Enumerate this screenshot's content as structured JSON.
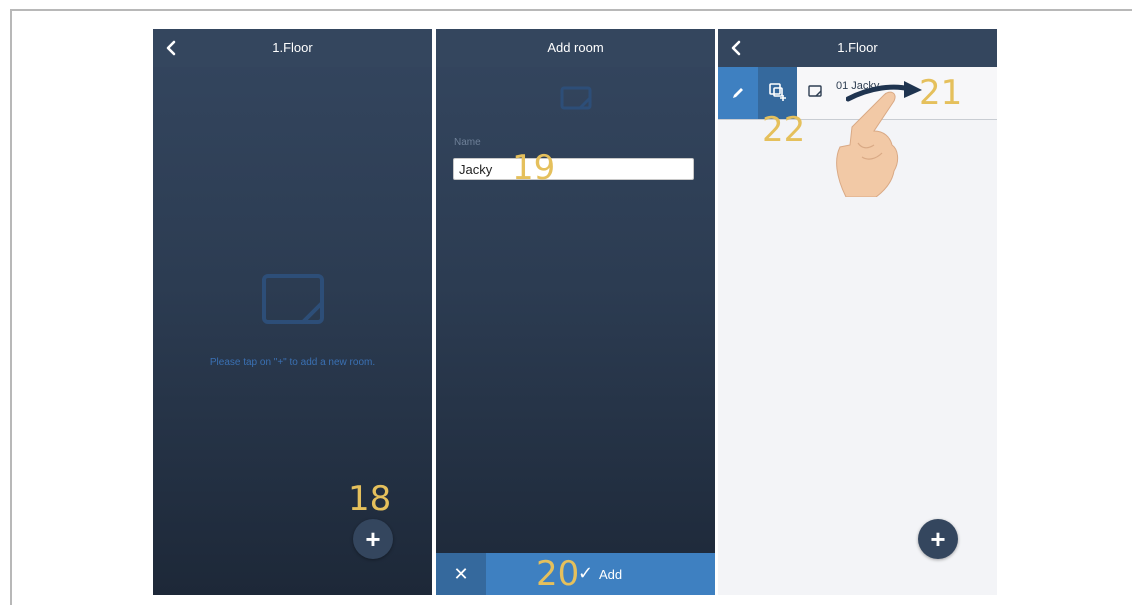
{
  "panels": [
    {
      "nav_title": "1.Floor",
      "empty_hint": "Please tap on \"+\" to add a new room.",
      "fab_label": "+",
      "annotation": "18"
    },
    {
      "nav_title": "Add room",
      "name_label": "Name",
      "name_value": "Jacky",
      "annotation_input": "19",
      "cancel_icon": "✕",
      "add_check": "✓",
      "add_label": "Add",
      "annotation_add": "20"
    },
    {
      "nav_title": "1.Floor",
      "room_label": "01 Jacky",
      "fab_label": "+",
      "annotation_swipe": "21",
      "annotation_copy": "22"
    }
  ],
  "colors": {
    "nav": "#34465e",
    "accent_blue": "#3e80c1",
    "accent_blue_dark": "#35699d",
    "annotation": "#e5c05c",
    "hint_text": "#3a70b3"
  },
  "icons": {
    "back": "chevron-left-icon",
    "room": "room-icon",
    "plus": "plus-icon",
    "close": "close-icon",
    "check": "check-icon",
    "edit": "pencil-icon",
    "copy": "copy-add-icon",
    "hand": "hand-swipe-icon"
  }
}
